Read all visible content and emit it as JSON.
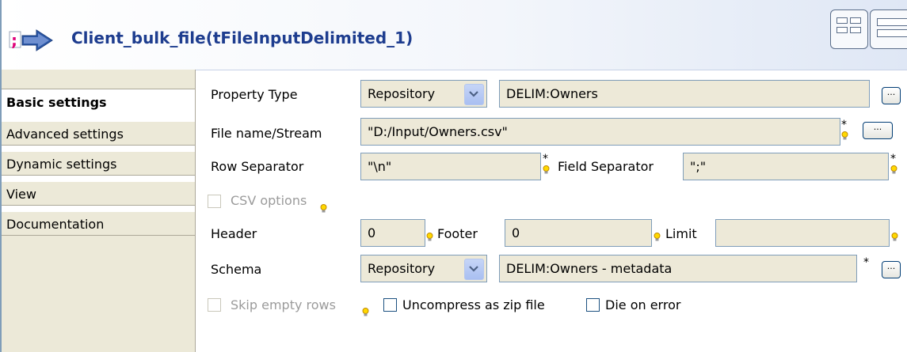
{
  "header": {
    "title": "Client_bulk_file(tFileInputDelimited_1)"
  },
  "tabs": [
    {
      "label": "Basic settings",
      "active": true
    },
    {
      "label": "Advanced settings",
      "active": false
    },
    {
      "label": "Dynamic settings",
      "active": false
    },
    {
      "label": "View",
      "active": false
    },
    {
      "label": "Documentation",
      "active": false
    }
  ],
  "form": {
    "property_type": {
      "label": "Property Type",
      "select_value": "Repository",
      "value": "DELIM:Owners"
    },
    "file_name": {
      "label": "File name/Stream",
      "value": "\"D:/Input/Owners.csv\""
    },
    "row_separator": {
      "label": "Row Separator",
      "value": "\"\\n\""
    },
    "field_separator": {
      "label": "Field Separator",
      "value": "\";\""
    },
    "csv_options": {
      "label": "CSV options",
      "checked": false,
      "enabled": false
    },
    "header": {
      "label": "Header",
      "value": "0"
    },
    "footer": {
      "label": "Footer",
      "value": "0"
    },
    "limit": {
      "label": "Limit",
      "value": ""
    },
    "schema": {
      "label": "Schema",
      "select_value": "Repository",
      "value": "DELIM:Owners - metadata"
    },
    "skip_empty_rows": {
      "label": "Skip empty rows",
      "checked": false,
      "enabled": false
    },
    "uncompress_zip": {
      "label": "Uncompress as zip file",
      "checked": false
    },
    "die_on_error": {
      "label": "Die on error",
      "checked": false
    }
  },
  "icons": {
    "ellipsis": "...",
    "required": "*"
  }
}
